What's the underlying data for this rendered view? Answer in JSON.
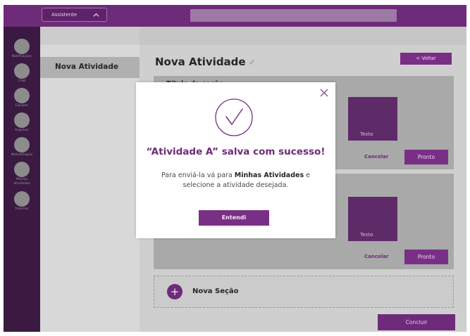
{
  "topbar": {
    "assistant_label": "Assistente",
    "search_placeholder": ""
  },
  "sidebar": {
    "items": [
      {
        "label": "Notificações"
      },
      {
        "label": "Chat"
      },
      {
        "label": "Equipes"
      },
      {
        "label": "Arquivos"
      },
      {
        "label": "Metodologias"
      },
      {
        "label": "Minhas atividades"
      },
      {
        "label": "Tutoriais"
      }
    ]
  },
  "panel": {
    "active_item": "Nova Atividade"
  },
  "main": {
    "title": "Nova Atividade",
    "back_button": "< Voltar",
    "sections": [
      {
        "title": "Título da seção",
        "texto": "Texto",
        "cancel": "Cancelar",
        "done": "Pronto"
      },
      {
        "title": "",
        "texto": "Texto",
        "cancel": "Cancelar",
        "done": "Pronto"
      }
    ],
    "new_section_label": "Nova Seção",
    "new_section_icon": "+",
    "finish_button": "Concluir"
  },
  "modal": {
    "title": "“Atividade A” salva com sucesso!",
    "body_prefix": "Para enviá-la vá para ",
    "body_bold": "Minhas Atividades",
    "body_suffix": " e selecione a atividade desejada.",
    "ok_button": "Entendi",
    "close_icon": "close-icon",
    "success_icon": "check-circle-icon"
  },
  "colors": {
    "brand": "#6e2b7a",
    "sidebar_bg": "#3b1a42"
  }
}
